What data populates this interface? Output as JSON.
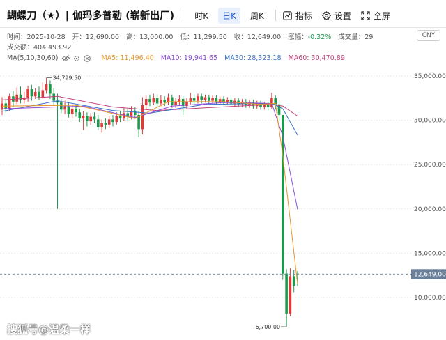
{
  "header": {
    "title": "蝴蝶刀（★）| 伽玛多普勒 (崭新出厂)",
    "tabs": [
      {
        "label": "时K",
        "active": false
      },
      {
        "label": "日K",
        "active": true
      },
      {
        "label": "周K",
        "active": false
      }
    ],
    "tools": {
      "indicators": "指标",
      "settings": "设置",
      "fullscreen": "全屏"
    }
  },
  "info": {
    "time": "时间：2025-10-28",
    "open": "开：12,690.00",
    "high": "高：13,000.00",
    "low": "低：11,299.50",
    "close": "收：12,649.00",
    "change_label": "涨幅：",
    "change_value": "-0.32%",
    "volume": "成交量：29",
    "amount": "成交额：404,493.92"
  },
  "ma": {
    "label": "MA(5,10,30,60)",
    "ma5": "MA5: 11,496.40",
    "ma10": "MA10: 19,941.65",
    "ma30": "MA30: 28,323.18",
    "ma60": "MA60: 30,470.89"
  },
  "currency": "CNY",
  "watermark": "搜狐号@温柔一样",
  "colors": {
    "up": "#e03a3a",
    "down": "#1a9a4a",
    "ma5": "#e7952b",
    "ma10": "#8a4bd8",
    "ma30": "#3a72c9",
    "ma60": "#c0417b",
    "current_price_tag": "#6b7f99"
  },
  "chart_data": {
    "type": "candlestick",
    "y_ticks": [
      35000,
      30000,
      25000,
      20000,
      15000,
      10000
    ],
    "y_tick_labels": [
      "35,000.00",
      "30,000.00",
      "25,000.00",
      "20,000.00",
      "15,000.00",
      "10,000.00"
    ],
    "ylim": [
      6000,
      37000
    ],
    "current_price": 12649,
    "current_price_label": "12,649.00",
    "max_label": "34,799.50",
    "min_label": "6,700.00",
    "grid": "horizontal dashed",
    "candles": [
      {
        "o": 31200,
        "c": 31900,
        "h": 32600,
        "l": 30600
      },
      {
        "o": 31900,
        "c": 31300,
        "h": 32400,
        "l": 30900
      },
      {
        "o": 31300,
        "c": 32700,
        "h": 33000,
        "l": 31000
      },
      {
        "o": 32700,
        "c": 32100,
        "h": 33300,
        "l": 31500
      },
      {
        "o": 32100,
        "c": 32900,
        "h": 33700,
        "l": 31800
      },
      {
        "o": 32900,
        "c": 32300,
        "h": 33800,
        "l": 31900
      },
      {
        "o": 32300,
        "c": 32500,
        "h": 33200,
        "l": 31900
      },
      {
        "o": 32500,
        "c": 33500,
        "h": 33900,
        "l": 32100
      },
      {
        "o": 33500,
        "c": 32700,
        "h": 34000,
        "l": 32200
      },
      {
        "o": 32700,
        "c": 33200,
        "h": 33600,
        "l": 32400
      },
      {
        "o": 33200,
        "c": 32600,
        "h": 33800,
        "l": 32300
      },
      {
        "o": 32600,
        "c": 33400,
        "h": 34300,
        "l": 32400
      },
      {
        "o": 33400,
        "c": 34100,
        "h": 34800,
        "l": 33000
      },
      {
        "o": 34100,
        "c": 33000,
        "h": 34500,
        "l": 32400
      },
      {
        "o": 33000,
        "c": 32200,
        "h": 33600,
        "l": 31800
      },
      {
        "o": 32200,
        "c": 32000,
        "h": 33000,
        "l": 20000
      },
      {
        "o": 32000,
        "c": 31200,
        "h": 32400,
        "l": 30800
      },
      {
        "o": 31200,
        "c": 31600,
        "h": 32200,
        "l": 30700
      },
      {
        "o": 31600,
        "c": 30700,
        "h": 32000,
        "l": 30300
      },
      {
        "o": 30700,
        "c": 31300,
        "h": 31800,
        "l": 30200
      },
      {
        "o": 31300,
        "c": 30900,
        "h": 31700,
        "l": 30400
      },
      {
        "o": 30900,
        "c": 30200,
        "h": 31300,
        "l": 29800
      },
      {
        "o": 30200,
        "c": 30500,
        "h": 31000,
        "l": 28900
      },
      {
        "o": 30500,
        "c": 29900,
        "h": 30900,
        "l": 29300
      },
      {
        "o": 29900,
        "c": 30400,
        "h": 30800,
        "l": 29500
      },
      {
        "o": 30400,
        "c": 30100,
        "h": 30900,
        "l": 29700
      },
      {
        "o": 30100,
        "c": 29200,
        "h": 30600,
        "l": 28900
      },
      {
        "o": 29200,
        "c": 29700,
        "h": 30100,
        "l": 28600
      },
      {
        "o": 29700,
        "c": 29500,
        "h": 30200,
        "l": 29000
      },
      {
        "o": 29500,
        "c": 30100,
        "h": 30500,
        "l": 29100
      },
      {
        "o": 30100,
        "c": 29800,
        "h": 30600,
        "l": 29300
      },
      {
        "o": 29800,
        "c": 30500,
        "h": 30900,
        "l": 29500
      },
      {
        "o": 30500,
        "c": 30200,
        "h": 31000,
        "l": 29800
      },
      {
        "o": 30200,
        "c": 30800,
        "h": 31400,
        "l": 29900
      },
      {
        "o": 30800,
        "c": 30400,
        "h": 31300,
        "l": 30000
      },
      {
        "o": 30400,
        "c": 31000,
        "h": 31600,
        "l": 30100
      },
      {
        "o": 31000,
        "c": 30600,
        "h": 31500,
        "l": 30200
      },
      {
        "o": 30600,
        "c": 29000,
        "h": 31000,
        "l": 28100
      },
      {
        "o": 29000,
        "c": 31700,
        "h": 32600,
        "l": 28400
      },
      {
        "o": 31700,
        "c": 32400,
        "h": 32800,
        "l": 31200
      },
      {
        "o": 32400,
        "c": 32000,
        "h": 32900,
        "l": 31600
      },
      {
        "o": 32000,
        "c": 32500,
        "h": 33000,
        "l": 31700
      },
      {
        "o": 32500,
        "c": 31900,
        "h": 32900,
        "l": 31500
      },
      {
        "o": 31900,
        "c": 32300,
        "h": 32800,
        "l": 31600
      },
      {
        "o": 32300,
        "c": 32000,
        "h": 32700,
        "l": 31600
      },
      {
        "o": 32000,
        "c": 32600,
        "h": 33000,
        "l": 31700
      },
      {
        "o": 32600,
        "c": 31700,
        "h": 32900,
        "l": 31400
      },
      {
        "o": 31700,
        "c": 32100,
        "h": 32500,
        "l": 31400
      },
      {
        "o": 32100,
        "c": 32400,
        "h": 32800,
        "l": 31700
      },
      {
        "o": 32400,
        "c": 31600,
        "h": 32700,
        "l": 30600
      },
      {
        "o": 31600,
        "c": 32100,
        "h": 32500,
        "l": 31300
      },
      {
        "o": 32100,
        "c": 32500,
        "h": 33100,
        "l": 31800
      },
      {
        "o": 32500,
        "c": 32200,
        "h": 32900,
        "l": 31800
      },
      {
        "o": 32200,
        "c": 32700,
        "h": 33000,
        "l": 31900
      },
      {
        "o": 32700,
        "c": 32300,
        "h": 33000,
        "l": 31900
      },
      {
        "o": 32300,
        "c": 32600,
        "h": 32900,
        "l": 32000
      },
      {
        "o": 32600,
        "c": 32200,
        "h": 32900,
        "l": 31900
      },
      {
        "o": 32200,
        "c": 32500,
        "h": 32800,
        "l": 31900
      },
      {
        "o": 32500,
        "c": 32100,
        "h": 32800,
        "l": 31800
      },
      {
        "o": 32100,
        "c": 32400,
        "h": 32700,
        "l": 31800
      },
      {
        "o": 32400,
        "c": 32000,
        "h": 32700,
        "l": 31700
      },
      {
        "o": 32000,
        "c": 32300,
        "h": 32600,
        "l": 31700
      },
      {
        "o": 32300,
        "c": 31900,
        "h": 32600,
        "l": 31600
      },
      {
        "o": 31900,
        "c": 32200,
        "h": 32500,
        "l": 31600
      },
      {
        "o": 32200,
        "c": 31800,
        "h": 32500,
        "l": 31500
      },
      {
        "o": 31800,
        "c": 32100,
        "h": 32400,
        "l": 31500
      },
      {
        "o": 32100,
        "c": 31700,
        "h": 32400,
        "l": 31400
      },
      {
        "o": 31700,
        "c": 32000,
        "h": 32300,
        "l": 31400
      },
      {
        "o": 32000,
        "c": 31600,
        "h": 32300,
        "l": 31300
      },
      {
        "o": 31600,
        "c": 31900,
        "h": 32200,
        "l": 31300
      },
      {
        "o": 31900,
        "c": 31500,
        "h": 32200,
        "l": 31200
      },
      {
        "o": 31500,
        "c": 31800,
        "h": 32100,
        "l": 31200
      },
      {
        "o": 31800,
        "c": 31500,
        "h": 32000,
        "l": 31100
      },
      {
        "o": 31500,
        "c": 32500,
        "h": 33100,
        "l": 31300
      },
      {
        "o": 32500,
        "c": 31800,
        "h": 32800,
        "l": 31200
      },
      {
        "o": 31800,
        "c": 30600,
        "h": 32000,
        "l": 30000
      },
      {
        "o": 30600,
        "c": 12700,
        "h": 30600,
        "l": 12000
      },
      {
        "o": 12700,
        "c": 8200,
        "h": 13200,
        "l": 6700
      },
      {
        "o": 8200,
        "c": 12400,
        "h": 13300,
        "l": 7900
      },
      {
        "o": 12400,
        "c": 11300,
        "h": 13100,
        "l": 10600
      },
      {
        "o": 12690,
        "c": 12649,
        "h": 13000,
        "l": 11299.5
      }
    ],
    "ma5_series": [
      {
        "i": 0,
        "v": 31600
      },
      {
        "i": 20,
        "v": 31700
      },
      {
        "i": 36,
        "v": 30200
      },
      {
        "i": 45,
        "v": 32100
      },
      {
        "i": 60,
        "v": 32100
      },
      {
        "i": 70,
        "v": 31800
      },
      {
        "i": 74,
        "v": 31900
      },
      {
        "i": 76,
        "v": 26000
      },
      {
        "i": 80,
        "v": 11496.4
      }
    ],
    "ma10_series": [
      {
        "i": 0,
        "v": 31300
      },
      {
        "i": 22,
        "v": 31600
      },
      {
        "i": 36,
        "v": 30300
      },
      {
        "i": 46,
        "v": 31600
      },
      {
        "i": 60,
        "v": 32000
      },
      {
        "i": 73,
        "v": 31900
      },
      {
        "i": 76,
        "v": 28200
      },
      {
        "i": 80,
        "v": 19941.65
      }
    ],
    "ma30_series": [
      {
        "i": 0,
        "v": 31000
      },
      {
        "i": 15,
        "v": 32200
      },
      {
        "i": 30,
        "v": 31100
      },
      {
        "i": 40,
        "v": 30800
      },
      {
        "i": 55,
        "v": 31800
      },
      {
        "i": 73,
        "v": 31900
      },
      {
        "i": 76,
        "v": 31300
      },
      {
        "i": 80,
        "v": 28323.18
      }
    ],
    "ma60_series": [
      {
        "i": 0,
        "v": 32300
      },
      {
        "i": 15,
        "v": 32700
      },
      {
        "i": 30,
        "v": 31500
      },
      {
        "i": 42,
        "v": 31100
      },
      {
        "i": 55,
        "v": 31400
      },
      {
        "i": 73,
        "v": 31800
      },
      {
        "i": 76,
        "v": 31600
      },
      {
        "i": 80,
        "v": 30470.89
      }
    ]
  }
}
